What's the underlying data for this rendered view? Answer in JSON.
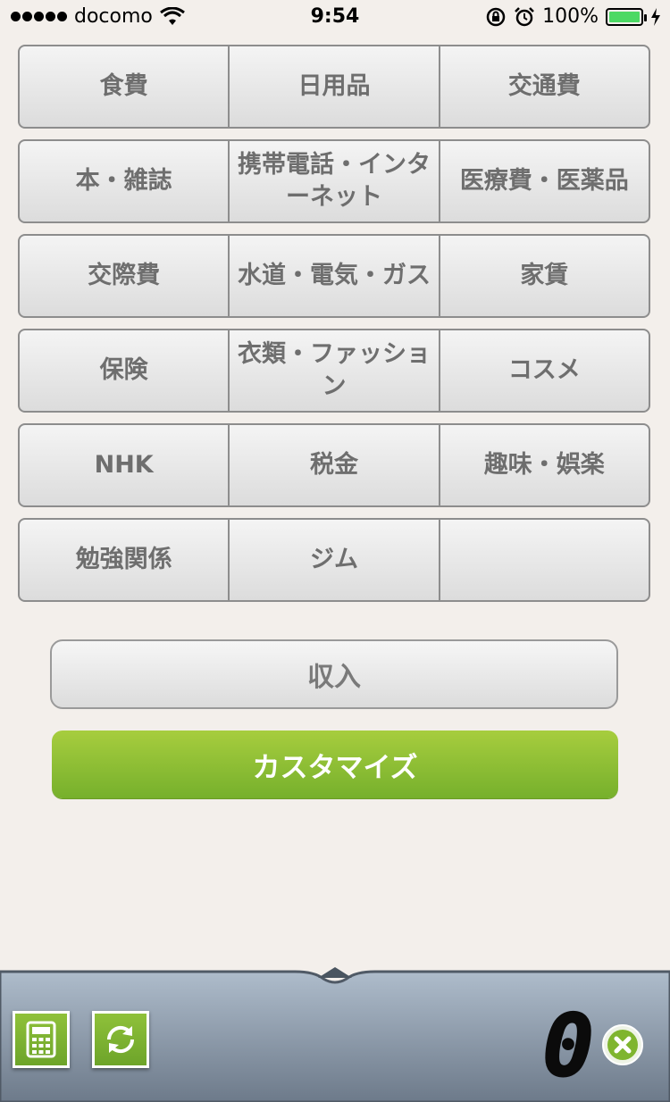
{
  "status_bar": {
    "carrier": "docomo",
    "time": "9:54",
    "battery": "100%"
  },
  "categories": [
    [
      "食費",
      "日用品",
      "交通費"
    ],
    [
      "本・雑誌",
      "携帯電話・インターネット",
      "医療費・医薬品"
    ],
    [
      "交際費",
      "水道・電気・ガス",
      "家賃"
    ],
    [
      "保険",
      "衣類・ファッション",
      "コスメ"
    ],
    [
      "NHK",
      "税金",
      "趣味・娯楽"
    ],
    [
      "勉強関係",
      "ジム",
      ""
    ]
  ],
  "buttons": {
    "income": "収入",
    "customize": "カスタマイズ"
  },
  "bottom_bar": {
    "amount": "0",
    "icons": [
      "calculator-icon",
      "refresh-icon",
      "clear-icon"
    ]
  },
  "colors": {
    "background": "#f3efeb",
    "accent_green": "#8fc13a",
    "battery_green": "#4cd964"
  }
}
